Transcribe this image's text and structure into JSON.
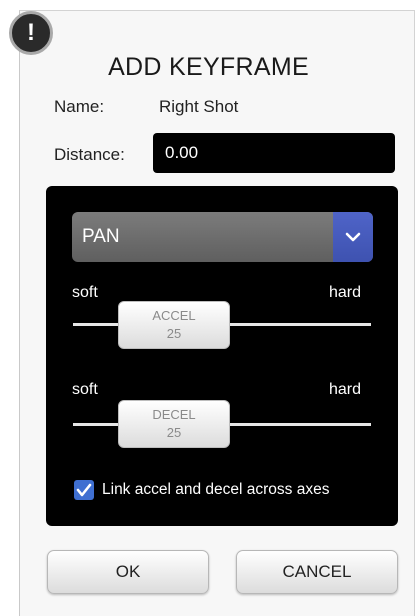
{
  "dialog": {
    "title": "ADD KEYFRAME",
    "alert_glyph": "!"
  },
  "fields": {
    "name_label": "Name:",
    "name_value": "Right Shot",
    "distance_label": "Distance:",
    "distance_value": "0.00"
  },
  "axis_select": {
    "selected": "PAN"
  },
  "accel": {
    "low_label": "soft",
    "high_label": "hard",
    "thumb_label": "ACCEL",
    "value": "25"
  },
  "decel": {
    "low_label": "soft",
    "high_label": "hard",
    "thumb_label": "DECEL",
    "value": "25"
  },
  "link_checkbox": {
    "checked": true,
    "label": "Link accel and decel across axes"
  },
  "buttons": {
    "ok_label": "OK",
    "cancel_label": "CANCEL"
  },
  "colors": {
    "panel_bg": "#000000",
    "dropdown_button": "#4a5fc4",
    "checkbox": "#3f6fd1",
    "dialog_bg": "#f7f7f7"
  },
  "icons": {
    "alert": "exclamation-icon",
    "dropdown": "chevron-down-icon",
    "checkbox": "checkmark-icon"
  }
}
